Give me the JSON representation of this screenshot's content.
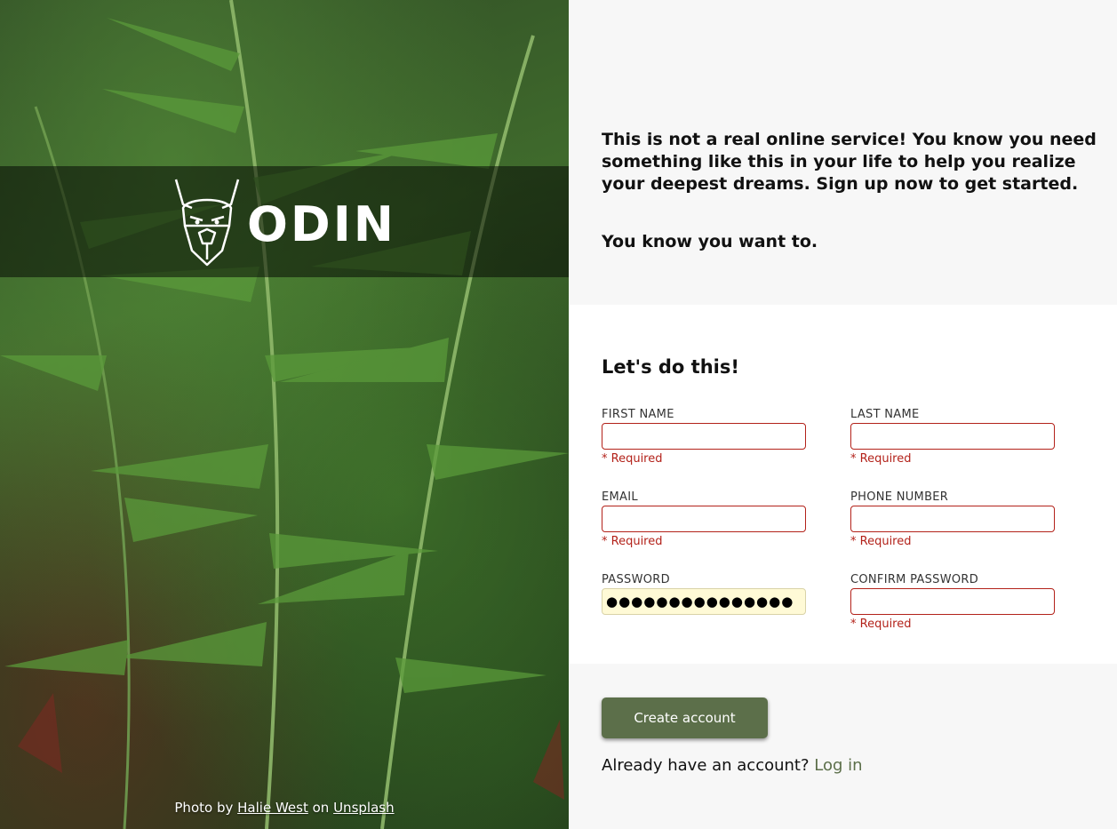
{
  "brand": {
    "name": "ODIN"
  },
  "intro": {
    "text": "This is not a real online service! You know you need something like this in your life to help you realize your deepest dreams. Sign up now to get started.",
    "tagline": "You know you want to."
  },
  "form": {
    "heading": "Let's do this!",
    "required_text": "* Required",
    "fields": {
      "first_name": {
        "label": "FIRST NAME",
        "value": ""
      },
      "last_name": {
        "label": "LAST NAME",
        "value": ""
      },
      "email": {
        "label": "EMAIL",
        "value": ""
      },
      "phone": {
        "label": "PHONE NUMBER",
        "value": ""
      },
      "password": {
        "label": "PASSWORD",
        "value": "●●●●●●●●●●●●●●●"
      },
      "confirm_password": {
        "label": "CONFIRM PASSWORD",
        "value": ""
      }
    }
  },
  "actions": {
    "submit_label": "Create account",
    "login_prompt": "Already have an account?",
    "login_link": "Log in"
  },
  "credit": {
    "prefix": "Photo by",
    "author": "Halie West",
    "middle": "on",
    "site": "Unsplash"
  },
  "colors": {
    "accent": "#5c6f4a",
    "error": "#b3221a",
    "autofill": "#fffad6"
  }
}
